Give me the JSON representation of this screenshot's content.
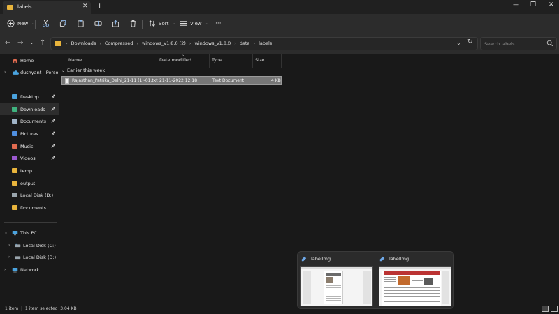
{
  "window": {
    "tab_title": "labels",
    "controls": {
      "minimize": "—",
      "maximize": "❐",
      "close": "✕"
    }
  },
  "toolbar": {
    "new_label": "New",
    "sort_label": "Sort",
    "view_label": "View",
    "more_label": "···"
  },
  "address": {
    "breadcrumbs": [
      "Downloads",
      "Compressed",
      "windows_v1.8.0 (2)",
      "windows_v1.8.0",
      "data",
      "labels"
    ],
    "search_placeholder": "Search labels"
  },
  "sidebar": {
    "home": "Home",
    "onedrive": "dushyant - Personal",
    "quick_access": [
      {
        "label": "Desktop",
        "color": "#4aa3df",
        "pinned": true
      },
      {
        "label": "Downloads",
        "color": "#3fb27f",
        "pinned": true
      },
      {
        "label": "Documents",
        "color": "#a0b4c8",
        "pinned": true
      },
      {
        "label": "Pictures",
        "color": "#4f8fe0",
        "pinned": true
      },
      {
        "label": "Music",
        "color": "#e06a4f",
        "pinned": true
      },
      {
        "label": "Videos",
        "color": "#9b59d0",
        "pinned": true
      },
      {
        "label": "temp",
        "color": "#e8b43c",
        "pinned": false
      },
      {
        "label": "output",
        "color": "#e8b43c",
        "pinned": false
      },
      {
        "label": "Local Disk (D:)",
        "color": "#9aa5ad",
        "pinned": false
      },
      {
        "label": "Documents",
        "color": "#e8b43c",
        "pinned": false
      }
    ],
    "this_pc": "This PC",
    "drives": [
      "Local Disk (C:)",
      "Local Disk (D:)"
    ],
    "network": "Network"
  },
  "content": {
    "columns": [
      "Name",
      "Date modified",
      "Type",
      "Size"
    ],
    "group_label": "Earlier this week",
    "files": [
      {
        "name": "Rajasthan_Patrika_Delhi_21-11 (1)-01.txt",
        "date": "21-11-2022 12:18",
        "type": "Text Document",
        "size": "4 KB"
      }
    ]
  },
  "status": {
    "text": "1 item  |  1 item selected  3.04 KB  |"
  },
  "taskbar_preview": {
    "windows": [
      {
        "title": "labelImg"
      },
      {
        "title": "labelImg"
      }
    ]
  },
  "colors": {
    "accent_folder": "#e8b43c",
    "selection": "#777777",
    "background": "#191919",
    "toolbar": "#2c2c2c"
  }
}
